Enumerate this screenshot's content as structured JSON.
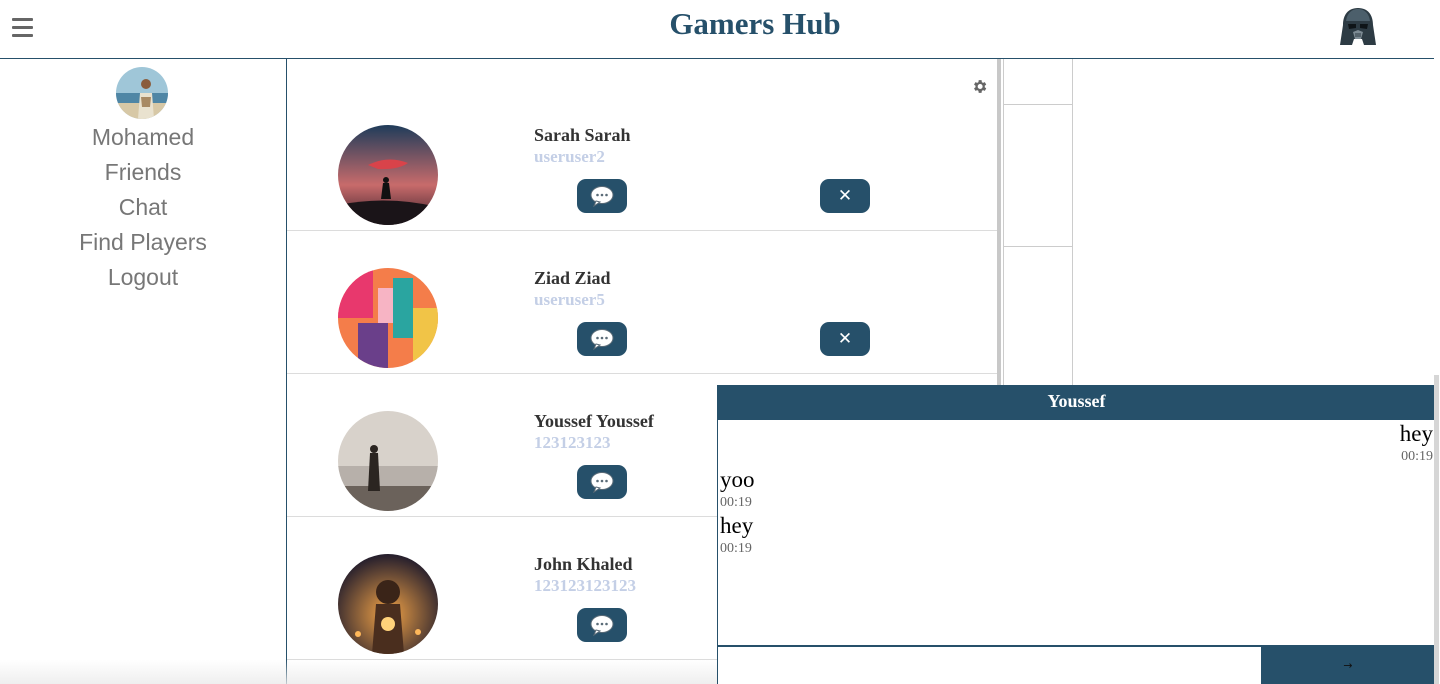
{
  "app": {
    "title": "Gamers Hub"
  },
  "header": {
    "menu_icon": "hamburger-menu-icon",
    "profile_icon": "darth-vader-helmet-icon"
  },
  "sidebar": {
    "user_name": "Mohamed",
    "links": [
      {
        "label": "Friends"
      },
      {
        "label": "Chat"
      },
      {
        "label": "Find Players"
      },
      {
        "label": "Logout"
      }
    ]
  },
  "friends": {
    "settings_icon": "gear-icon",
    "list": [
      {
        "name": "Sarah Sarah",
        "username": "useruser2",
        "has_remove": true,
        "remove_label": "✕"
      },
      {
        "name": "Ziad Ziad",
        "username": "useruser5",
        "has_remove": true,
        "remove_label": "✕"
      },
      {
        "name": "Youssef Youssef",
        "username": "123123123",
        "has_remove": false
      },
      {
        "name": "John Khaled",
        "username": "123123123123",
        "has_remove": false
      }
    ]
  },
  "chat": {
    "title": "Youssef",
    "messages": [
      {
        "text": "hey",
        "time": "00:19",
        "side": "right"
      },
      {
        "text": "yoo",
        "time": "00:19",
        "side": "left"
      },
      {
        "text": "hey",
        "time": "00:19",
        "side": "left"
      }
    ],
    "input_value": "",
    "send_label": "→"
  },
  "colors": {
    "primary": "#26506a",
    "username": "#c4cfe6",
    "sidebar_text": "#777777"
  }
}
